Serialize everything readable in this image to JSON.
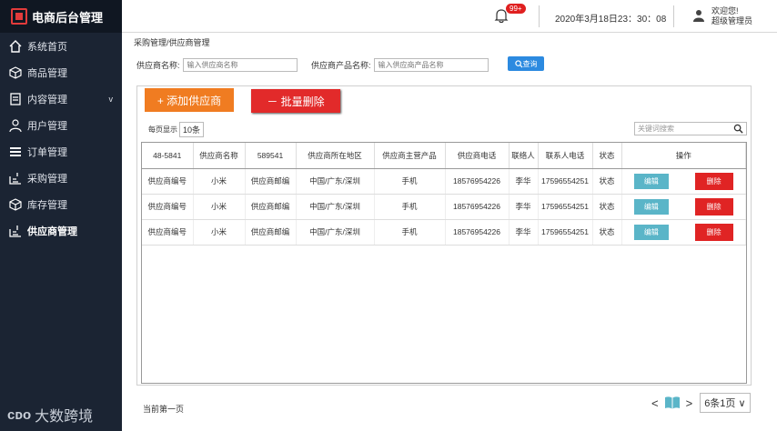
{
  "app": {
    "title": "电商后台管理"
  },
  "sidebar": {
    "items": [
      {
        "label": "系统首页",
        "icon": "home-icon"
      },
      {
        "label": "商品管理",
        "icon": "box-icon"
      },
      {
        "label": "内容管理",
        "icon": "document-icon",
        "caret": "v"
      },
      {
        "label": "用户管理",
        "icon": "user-icon"
      },
      {
        "label": "订单管理",
        "icon": "list-icon"
      },
      {
        "label": "采购管理",
        "icon": "cart-icon"
      },
      {
        "label": "库存管理",
        "icon": "box-icon"
      },
      {
        "label": "供应商管理",
        "icon": "supplier-icon",
        "active": true
      }
    ],
    "footer": {
      "mark": "ᴄᴅᴏ",
      "text": "大数跨境"
    }
  },
  "topbar": {
    "badge": "99+",
    "datetime": "2020年3月18日23：30：08",
    "welcome_line1": "欢迎您!",
    "welcome_line2": "超级管理员"
  },
  "breadcrumb": "采购管理/供应商管理",
  "filters": {
    "supplier_name_label": "供应商名称:",
    "supplier_name_placeholder": "输入供应商名称",
    "product_name_label": "供应商产品名称:",
    "product_name_placeholder": "输入供应商产品名称",
    "query_label": "查询"
  },
  "actions": {
    "add_label": "+ 添加供应商",
    "delete_label": "－ 批量删除"
  },
  "list": {
    "page_size_label": "每页显示",
    "page_size_value": "10条",
    "search_placeholder": "关键词搜索",
    "columns": [
      "48-5841",
      "供应商名称",
      "589541",
      "供应商所在地区",
      "供应商主营产品",
      "供应商电话",
      "联络人",
      "联系人电话",
      "状态",
      "操作"
    ],
    "rows": [
      [
        "供应商编号",
        "小米",
        "供应商邮编",
        "中国/广东/深圳",
        "手机",
        "18576954226",
        "李华",
        "17596554251",
        "状态"
      ],
      [
        "供应商编号",
        "小米",
        "供应商邮编",
        "中国/广东/深圳",
        "手机",
        "18576954226",
        "李华",
        "17596554251",
        "状态"
      ],
      [
        "供应商编号",
        "小米",
        "供应商邮编",
        "中国/广东/深圳",
        "手机",
        "18576954226",
        "李华",
        "17596554251",
        "状态"
      ]
    ],
    "edit_label": "编辑",
    "remove_label": "删除"
  },
  "pager": {
    "current": "当前第一页",
    "prev": "<",
    "next": ">",
    "count": "6条1页 ∨"
  },
  "colors": {
    "sidebar": "#1b2433",
    "add": "#f07c21",
    "danger": "#e22a2a",
    "edit": "#5ab5c8",
    "query": "#2c8ae0"
  }
}
